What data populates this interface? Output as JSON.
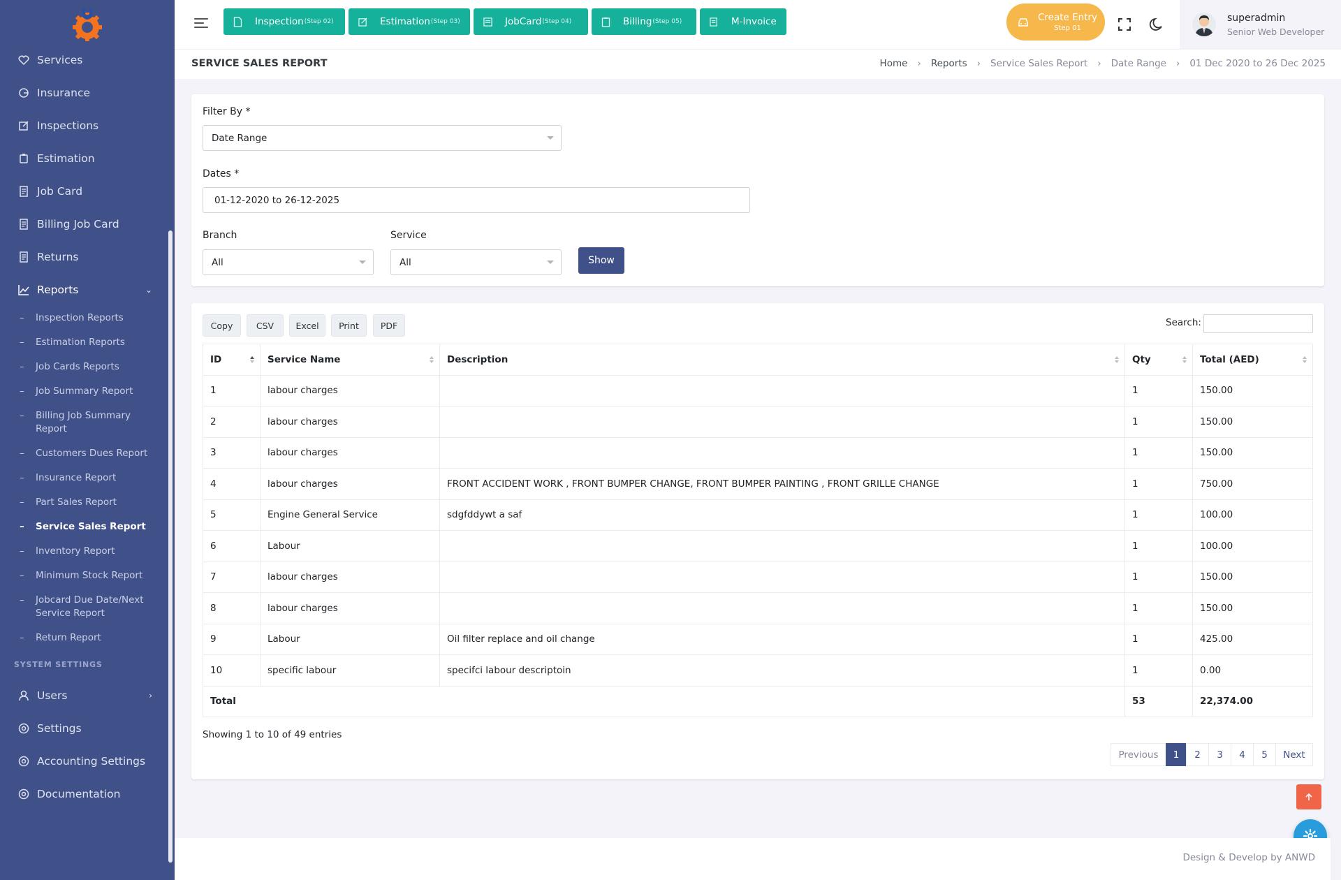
{
  "sidebar": {
    "items": [
      {
        "label": "Services"
      },
      {
        "label": "Insurance"
      },
      {
        "label": "Inspections"
      },
      {
        "label": "Estimation"
      },
      {
        "label": "Job Card"
      },
      {
        "label": "Billing Job Card"
      },
      {
        "label": "Returns"
      },
      {
        "label": "Reports"
      }
    ],
    "reports_sub": [
      "Inspection Reports",
      "Estimation Reports",
      "Job Cards Reports",
      "Job Summary Report",
      "Billing Job Summary Report",
      "Customers Dues Report",
      "Insurance Report",
      "Part Sales Report",
      "Service Sales Report",
      "Inventory Report",
      "Minimum Stock Report",
      "Jobcard Due Date/Next Service Report",
      "Return Report"
    ],
    "system_label": "SYSTEM SETTINGS",
    "system_items": [
      {
        "label": "Users"
      },
      {
        "label": "Settings"
      },
      {
        "label": "Accounting Settings"
      },
      {
        "label": "Documentation"
      }
    ]
  },
  "topbar": {
    "steps": [
      {
        "label": "Inspection",
        "step": "(Step 02)"
      },
      {
        "label": "Estimation",
        "step": "(Step 03)"
      },
      {
        "label": "JobCard",
        "step": "(Step 04)"
      },
      {
        "label": "Billing",
        "step": "(Step 05)"
      },
      {
        "label": "M-Invoice",
        "step": ""
      }
    ],
    "create_entry": "Create Entry",
    "create_step": "Step 01",
    "user_name": "superadmin",
    "user_role": "Senior Web Developer"
  },
  "page": {
    "title": "SERVICE SALES REPORT",
    "breadcrumb": [
      "Home",
      "Reports",
      "Service Sales Report",
      "Date Range",
      "01 Dec 2020 to 26 Dec 2025"
    ]
  },
  "filter": {
    "filter_by_label": "Filter By *",
    "filter_by_value": "Date Range",
    "dates_label": "Dates *",
    "dates_value": "01-12-2020 to 26-12-2025",
    "branch_label": "Branch",
    "branch_value": "All",
    "service_label": "Service",
    "service_value": "All",
    "show_button": "Show"
  },
  "table": {
    "export_buttons": [
      "Copy",
      "CSV",
      "Excel",
      "Print",
      "PDF"
    ],
    "search_label": "Search:",
    "columns": [
      "ID",
      "Service Name",
      "Description",
      "Qty",
      "Total (AED)"
    ],
    "rows": [
      [
        "1",
        "labour charges",
        "",
        "1",
        "150.00"
      ],
      [
        "2",
        "labour charges",
        "",
        "1",
        "150.00"
      ],
      [
        "3",
        "labour charges",
        "",
        "1",
        "150.00"
      ],
      [
        "4",
        "labour charges",
        "FRONT ACCIDENT WORK , FRONT BUMPER CHANGE, FRONT BUMPER PAINTING , FRONT GRILLE CHANGE",
        "1",
        "750.00"
      ],
      [
        "5",
        "Engine General Service",
        "sdgfddywt a saf",
        "1",
        "100.00"
      ],
      [
        "6",
        "Labour",
        "",
        "1",
        "100.00"
      ],
      [
        "7",
        "labour charges",
        "",
        "1",
        "150.00"
      ],
      [
        "8",
        "labour charges",
        "",
        "1",
        "150.00"
      ],
      [
        "9",
        "Labour",
        "Oil filter replace and oil change",
        "1",
        "425.00"
      ],
      [
        "10",
        "specific labour",
        "specifci labour descriptoin",
        "1",
        "0.00"
      ]
    ],
    "total_label": "Total",
    "total_qty": "53",
    "total_amount": "22,374.00",
    "showing": "Showing 1 to 10 of 49 entries",
    "pagination": [
      "Previous",
      "1",
      "2",
      "3",
      "4",
      "5",
      "Next"
    ]
  },
  "footer": {
    "text": "Design & Develop by ANWD"
  },
  "colors": {
    "sidebar": "#405189",
    "step_button": "#16b19b",
    "create_entry": "#f7b84b",
    "primary": "#405189",
    "back_top": "#f06548",
    "settings_fab": "#299cdb"
  }
}
